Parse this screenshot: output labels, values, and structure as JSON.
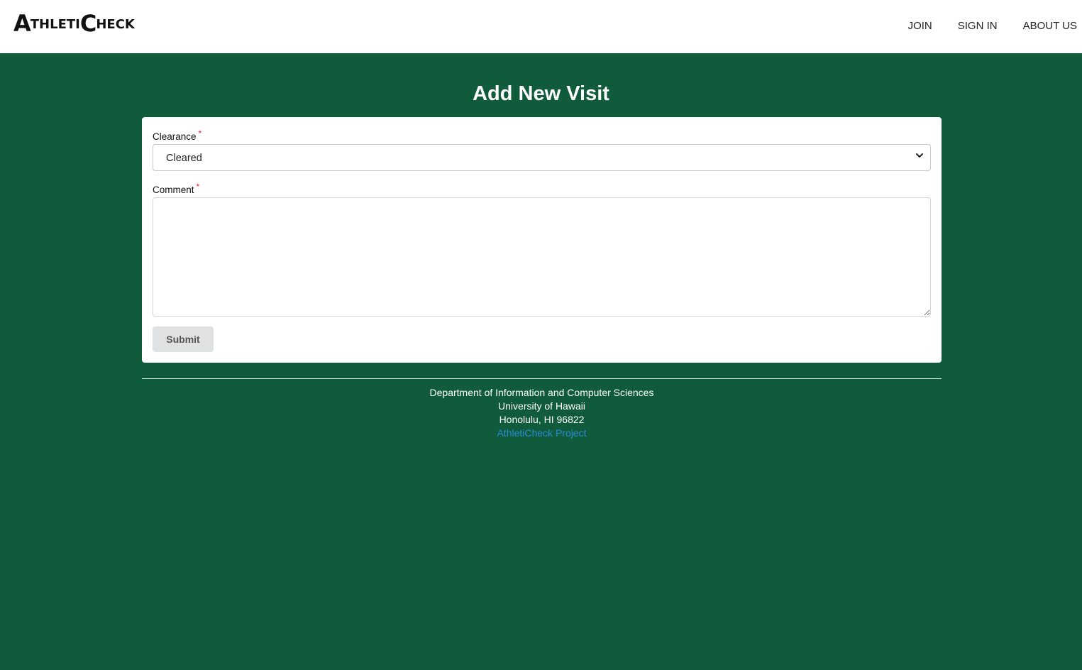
{
  "navbar": {
    "logo": {
      "part1_big": "A",
      "part1_small": "THLETI",
      "part2_big": "C",
      "part2_small": "HECK"
    },
    "links": [
      "JOIN",
      "SIGN IN",
      "ABOUT US"
    ]
  },
  "page": {
    "title": "Add New Visit"
  },
  "form": {
    "clearance_label": "Clearance",
    "required_marker": "*",
    "clearance_value": "Cleared",
    "comment_label": "Comment",
    "comment_value": "",
    "submit_label": "Submit"
  },
  "footer": {
    "line1": "Department of Information and Computer Sciences",
    "line2": "University of Hawaii",
    "line3": "Honolulu, HI 96822",
    "link_text": "AthletiCheck Project"
  },
  "colors": {
    "background": "#0f5b3b",
    "link": "#2b8bd6",
    "required": "#db2828",
    "button": "#e0e1e2"
  }
}
